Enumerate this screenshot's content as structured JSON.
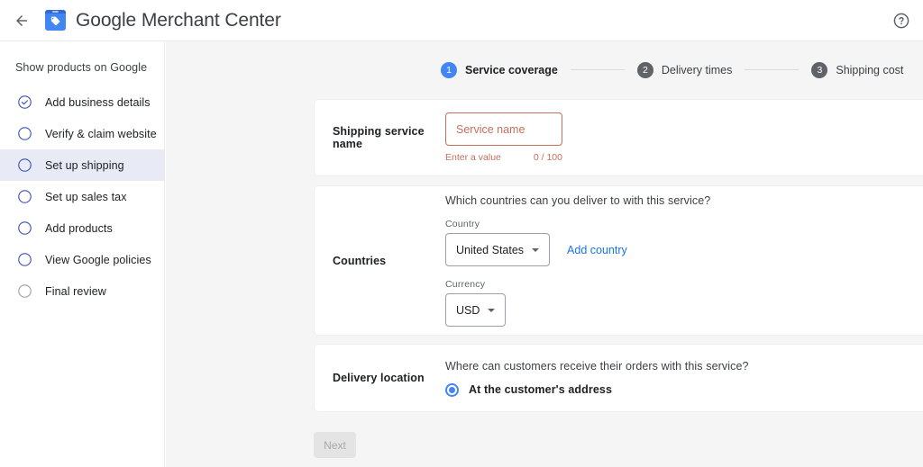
{
  "header": {
    "back_icon": "arrow-left-icon",
    "logo_icon": "merchant-center-tag-logo",
    "brand_google": "Google",
    "brand_rest": " Merchant Center",
    "help_icon": "help-circle-icon"
  },
  "sidebar": {
    "title": "Show products on Google",
    "items": [
      {
        "label": "Add business details",
        "state": "done",
        "icon": "check-circle-icon"
      },
      {
        "label": "Verify & claim website",
        "state": "todo",
        "icon": "circle-icon"
      },
      {
        "label": "Set up shipping",
        "state": "active",
        "icon": "circle-icon"
      },
      {
        "label": "Set up sales tax",
        "state": "todo",
        "icon": "circle-icon"
      },
      {
        "label": "Add products",
        "state": "todo",
        "icon": "circle-icon"
      },
      {
        "label": "View Google policies",
        "state": "todo",
        "icon": "circle-icon"
      },
      {
        "label": "Final review",
        "state": "muted",
        "icon": "circle-icon"
      }
    ]
  },
  "stepper": {
    "steps": [
      {
        "number": "1",
        "label": "Service coverage",
        "state": "active"
      },
      {
        "number": "2",
        "label": "Delivery times",
        "state": "inactive"
      },
      {
        "number": "3",
        "label": "Shipping cost",
        "state": "inactive"
      }
    ]
  },
  "service_name_card": {
    "label": "Shipping service name",
    "input_value": "",
    "input_placeholder": "Service name",
    "error_text": "Enter a value",
    "counter_text": "0 / 100"
  },
  "countries_card": {
    "label": "Countries",
    "question": "Which countries can you deliver to with this service?",
    "country_label": "Country",
    "country_value": "United States",
    "add_country_link": "Add country",
    "currency_label": "Currency",
    "currency_value": "USD"
  },
  "delivery_card": {
    "label": "Delivery location",
    "question": "Where can customers receive their orders with this service?",
    "option_label": "At the customer's address",
    "option_selected": true
  },
  "footer": {
    "next_label": "Next"
  },
  "colors": {
    "accent_blue": "#4285f4",
    "link_blue": "#1a73e8",
    "error_red": "#c5705d",
    "active_nav_bg": "#e8eaf6",
    "content_bg": "#f5f5f5",
    "step_inactive": "#5f6368"
  }
}
